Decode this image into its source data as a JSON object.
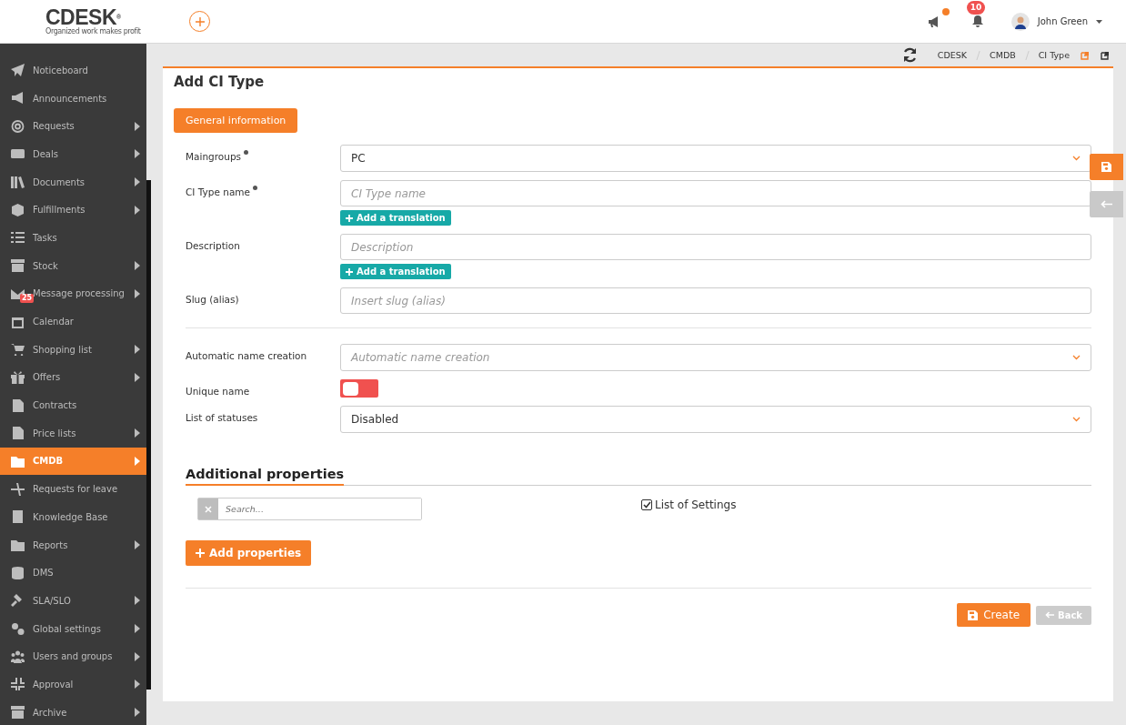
{
  "header": {
    "logo": "CDESK",
    "logo_mark": "®",
    "tagline": "Organized work makes profit",
    "announcements_unread": true,
    "notifications_count": "10",
    "user_name": "John Green"
  },
  "sidebar": {
    "items": [
      {
        "label": "Noticeboard",
        "expandable": false,
        "selected": false
      },
      {
        "label": "Announcements",
        "expandable": false,
        "selected": false
      },
      {
        "label": "Requests",
        "expandable": true,
        "selected": false
      },
      {
        "label": "Deals",
        "expandable": true,
        "selected": false
      },
      {
        "label": "Documents",
        "expandable": true,
        "selected": false
      },
      {
        "label": "Fulfillments",
        "expandable": true,
        "selected": false
      },
      {
        "label": "Tasks",
        "expandable": false,
        "selected": false
      },
      {
        "label": "Stock",
        "expandable": true,
        "selected": false
      },
      {
        "label": "Message processing",
        "expandable": true,
        "selected": false,
        "badge": "25"
      },
      {
        "label": "Calendar",
        "expandable": false,
        "selected": false
      },
      {
        "label": "Shopping list",
        "expandable": true,
        "selected": false
      },
      {
        "label": "Offers",
        "expandable": true,
        "selected": false
      },
      {
        "label": "Contracts",
        "expandable": false,
        "selected": false
      },
      {
        "label": "Price lists",
        "expandable": true,
        "selected": false
      },
      {
        "label": "CMDB",
        "expandable": true,
        "selected": true
      },
      {
        "label": "Requests for leave",
        "expandable": false,
        "selected": false
      },
      {
        "label": "Knowledge Base",
        "expandable": false,
        "selected": false
      },
      {
        "label": "Reports",
        "expandable": true,
        "selected": false
      },
      {
        "label": "DMS",
        "expandable": false,
        "selected": false
      },
      {
        "label": "SLA/SLO",
        "expandable": true,
        "selected": false
      },
      {
        "label": "Global settings",
        "expandable": true,
        "selected": false
      },
      {
        "label": "Users and groups",
        "expandable": true,
        "selected": false
      },
      {
        "label": "Approval",
        "expandable": true,
        "selected": false
      },
      {
        "label": "Archive",
        "expandable": true,
        "selected": false
      }
    ]
  },
  "breadcrumb": [
    "CDESK",
    "CMDB",
    "CI Type"
  ],
  "page_title": "Add CI Type",
  "section_tab": "General information",
  "fields": [
    {
      "kind": "select",
      "label": "Maingroups",
      "required": true,
      "value": "PC"
    },
    {
      "kind": "text",
      "label": "CI Type name",
      "required": true,
      "placeholder": "CI Type name",
      "translation": "Add a translation"
    },
    {
      "kind": "text",
      "label": "Description",
      "required": false,
      "placeholder": "Description",
      "translation": "Add a translation"
    },
    {
      "kind": "text",
      "label": "Slug (alias)",
      "required": false,
      "placeholder": "Insert slug (alias)"
    },
    {
      "kind": "divider"
    },
    {
      "kind": "select",
      "label": "Automatic name creation",
      "required": false,
      "placeholder": "Automatic name creation"
    },
    {
      "kind": "toggle",
      "label": "Unique name",
      "required": false,
      "on": false
    },
    {
      "kind": "select",
      "label": "List of statuses",
      "required": false,
      "value": "Disabled"
    }
  ],
  "additional": {
    "title": "Additional properties",
    "search_placeholder": "Search...",
    "checkbox_label": "List of Settings",
    "checkbox_checked": true,
    "add_button": "Add properties"
  },
  "actions": {
    "create": "Create",
    "back": "Back"
  }
}
